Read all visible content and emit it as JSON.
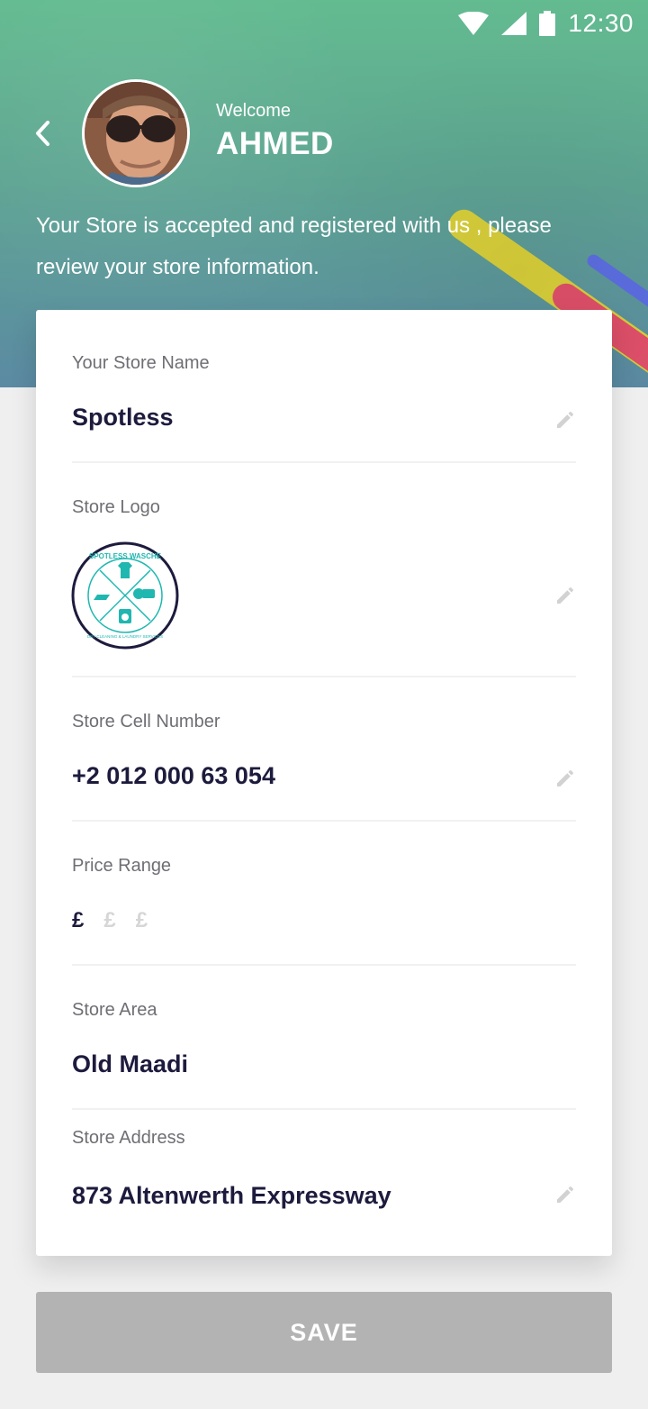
{
  "status_bar": {
    "time": "12:30"
  },
  "header": {
    "welcome_label": "Welcome",
    "user_name": "AHMED",
    "message": "Your Store is accepted and registered with us , please review your store information."
  },
  "form": {
    "store_name": {
      "label": "Your Store Name",
      "value": "Spotless"
    },
    "store_logo": {
      "label": "Store Logo",
      "logo_top_text": "SPOTLESS WASCHE",
      "logo_bottom_text": "DRY CLEANING & LAUNDRY SERVICES"
    },
    "cell_number": {
      "label": "Store Cell Number",
      "value": "+2 012 000 63 054"
    },
    "price_range": {
      "label": "Price Range",
      "symbols": [
        "£",
        "£",
        "£"
      ],
      "selected_level": 1,
      "max_level": 3
    },
    "store_area": {
      "label": "Store Area",
      "value": "Old Maadi"
    },
    "store_address": {
      "label": "Store Address",
      "value": "873 Altenwerth Expressway"
    }
  },
  "save_button": {
    "label": "SAVE"
  },
  "colors": {
    "header_top": "#63bb90",
    "header_bottom": "#5b8aa3",
    "value_text": "#1d1b3d",
    "label_text": "#6e6e74",
    "button_bg": "#b3b3b3",
    "logo_teal": "#1fb7b0"
  }
}
